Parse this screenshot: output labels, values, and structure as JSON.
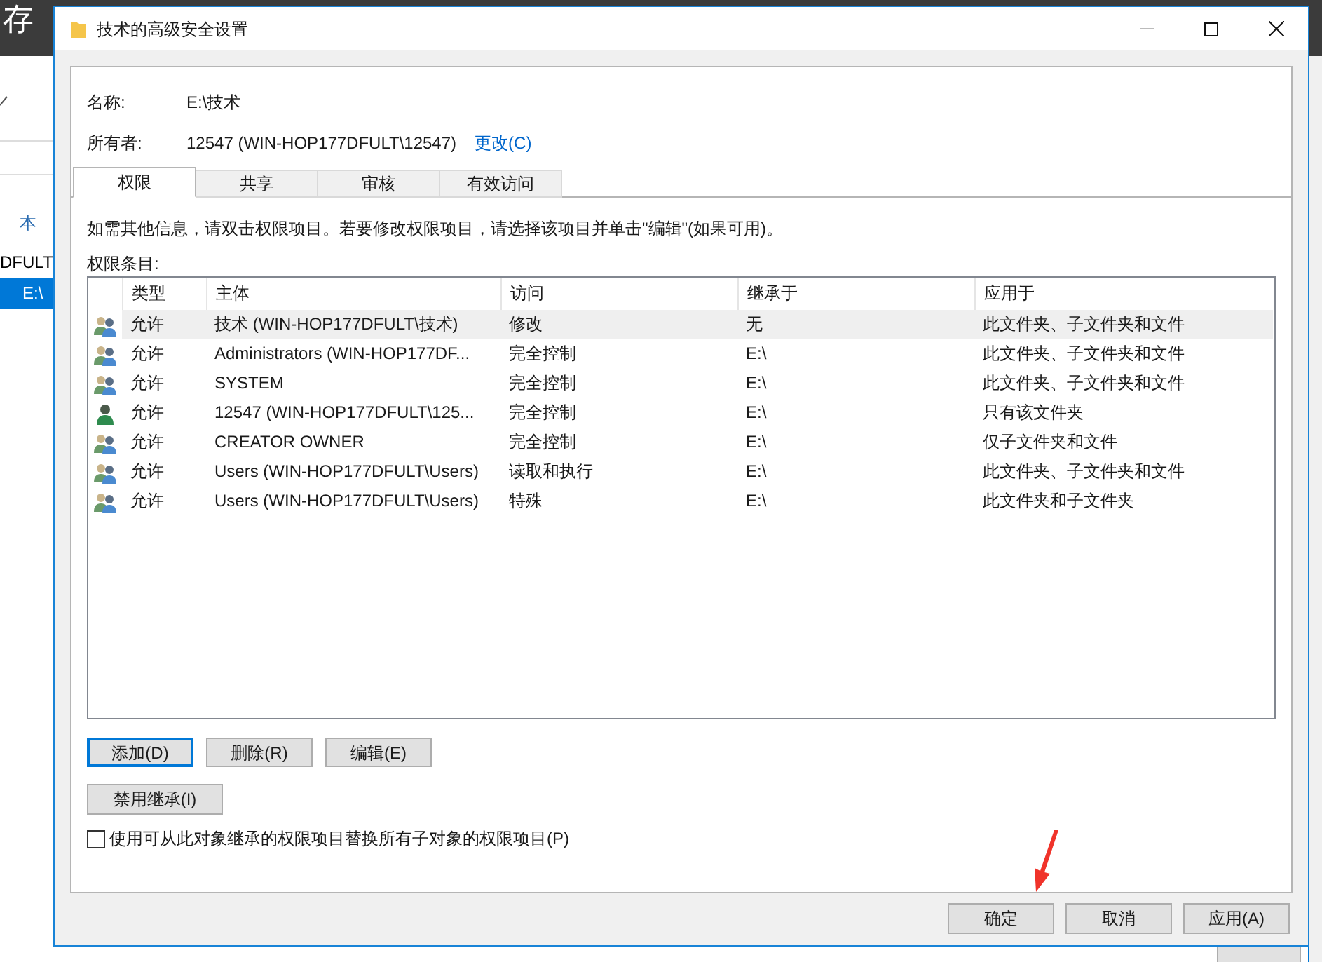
{
  "background_window": {
    "title": "存",
    "sidebar": [
      {
        "label": "本",
        "kind": "link",
        "selected": false
      },
      {
        "label": "DFULT",
        "kind": "text",
        "selected": false
      },
      {
        "label": "E:\\",
        "kind": "text",
        "selected": true
      }
    ]
  },
  "window": {
    "title": "技术的高级安全设置"
  },
  "name": {
    "label": "名称:",
    "value": "E:\\技术"
  },
  "owner": {
    "label": "所有者:",
    "value": "12547 (WIN-HOP177DFULT\\12547)",
    "link": "更改(C)"
  },
  "tabs": [
    {
      "label": "权限",
      "selected": true
    },
    {
      "label": "共享",
      "selected": false
    },
    {
      "label": "审核",
      "selected": false
    },
    {
      "label": "有效访问",
      "selected": false
    }
  ],
  "info": "如需其他信息，请双击权限项目。若要修改权限项目，请选择该项目并单击\"编辑\"(如果可用)。",
  "list_label": "权限条目:",
  "table": {
    "columns": [
      "类型",
      "主体",
      "访问",
      "继承于",
      "应用于"
    ],
    "rows": [
      {
        "kind": "group",
        "selected": true,
        "cells": [
          "允许",
          "技术 (WIN-HOP177DFULT\\技术)",
          "修改",
          "无",
          "此文件夹、子文件夹和文件"
        ]
      },
      {
        "kind": "group",
        "selected": false,
        "cells": [
          "允许",
          "Administrators (WIN-HOP177DF...",
          "完全控制",
          "E:\\",
          "此文件夹、子文件夹和文件"
        ]
      },
      {
        "kind": "group",
        "selected": false,
        "cells": [
          "允许",
          "SYSTEM",
          "完全控制",
          "E:\\",
          "此文件夹、子文件夹和文件"
        ]
      },
      {
        "kind": "user",
        "selected": false,
        "cells": [
          "允许",
          "12547 (WIN-HOP177DFULT\\125...",
          "完全控制",
          "E:\\",
          "只有该文件夹"
        ]
      },
      {
        "kind": "group",
        "selected": false,
        "cells": [
          "允许",
          "CREATOR OWNER",
          "完全控制",
          "E:\\",
          "仅子文件夹和文件"
        ]
      },
      {
        "kind": "group",
        "selected": false,
        "cells": [
          "允许",
          "Users (WIN-HOP177DFULT\\Users)",
          "读取和执行",
          "E:\\",
          "此文件夹、子文件夹和文件"
        ]
      },
      {
        "kind": "group",
        "selected": false,
        "cells": [
          "允许",
          "Users (WIN-HOP177DFULT\\Users)",
          "特殊",
          "E:\\",
          "此文件夹和子文件夹"
        ]
      }
    ]
  },
  "entry_buttons": [
    {
      "label": "添加(D)",
      "focused": true
    },
    {
      "label": "删除(R)",
      "focused": false
    },
    {
      "label": "编辑(E)",
      "focused": false
    }
  ],
  "inherit_button": "禁用继承(I)",
  "replace_checkbox": {
    "label": "使用可从此对象继承的权限项目替换所有子对象的权限项目(P)",
    "checked": false
  },
  "footer_buttons": [
    "确定",
    "取消",
    "应用(A)"
  ]
}
